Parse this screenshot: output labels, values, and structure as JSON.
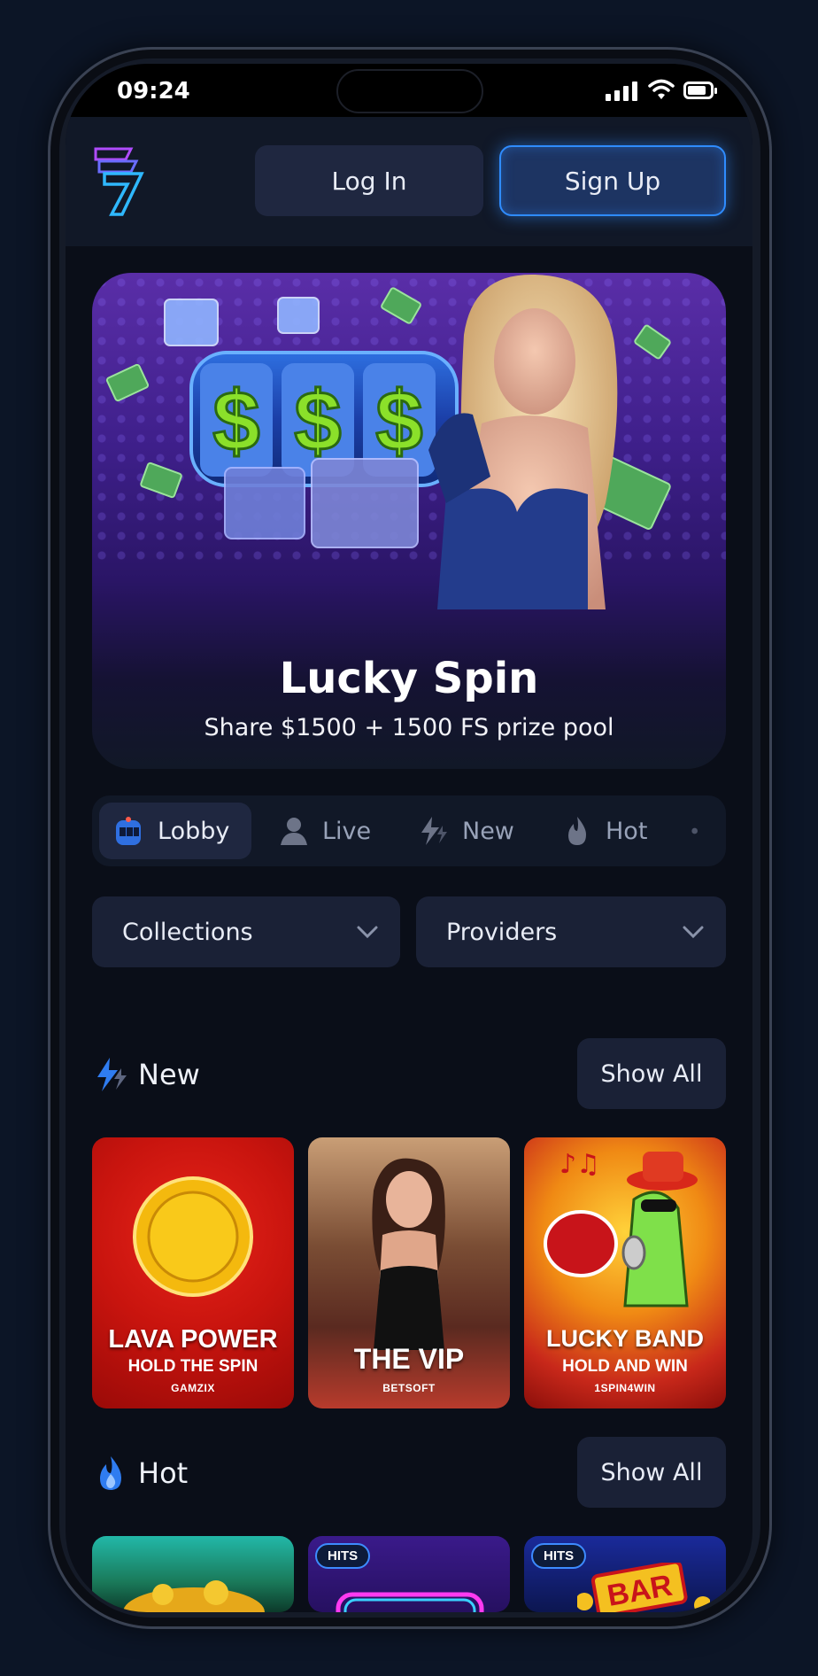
{
  "status_bar": {
    "time": "09:24"
  },
  "header": {
    "login_label": "Log In",
    "signup_label": "Sign Up",
    "logo_icon": "seven-logo-icon"
  },
  "banner": {
    "title": "Lucky Spin",
    "subtitle": "Share $1500 + 1500 FS prize pool"
  },
  "tabs": [
    {
      "label": "Lobby",
      "icon": "slot-machine-icon",
      "active": true
    },
    {
      "label": "Live",
      "icon": "dealer-icon",
      "active": false
    },
    {
      "label": "New",
      "icon": "lightning-icon",
      "active": false
    },
    {
      "label": "Hot",
      "icon": "flame-icon",
      "active": false
    }
  ],
  "filters": {
    "collections_label": "Collections",
    "providers_label": "Providers"
  },
  "sections": {
    "new": {
      "title": "New",
      "show_all": "Show All",
      "games": [
        {
          "name": "LAVA POWER",
          "subtitle": "HOLD THE SPIN",
          "provider": "GAMZIX"
        },
        {
          "name": "THE VIP",
          "subtitle": "",
          "provider": "BETSOFT"
        },
        {
          "name": "LUCKY BAND",
          "subtitle": "HOLD AND WIN",
          "provider": "1SPIN4WIN"
        }
      ]
    },
    "hot": {
      "title": "Hot",
      "show_all": "Show All",
      "games": [
        {
          "badge": ""
        },
        {
          "badge": "HITS"
        },
        {
          "badge": "HITS",
          "art_text": "BAR"
        }
      ]
    }
  },
  "colors": {
    "accent": "#2f8cff",
    "background": "#0a0e18",
    "surface": "#1a2136"
  }
}
